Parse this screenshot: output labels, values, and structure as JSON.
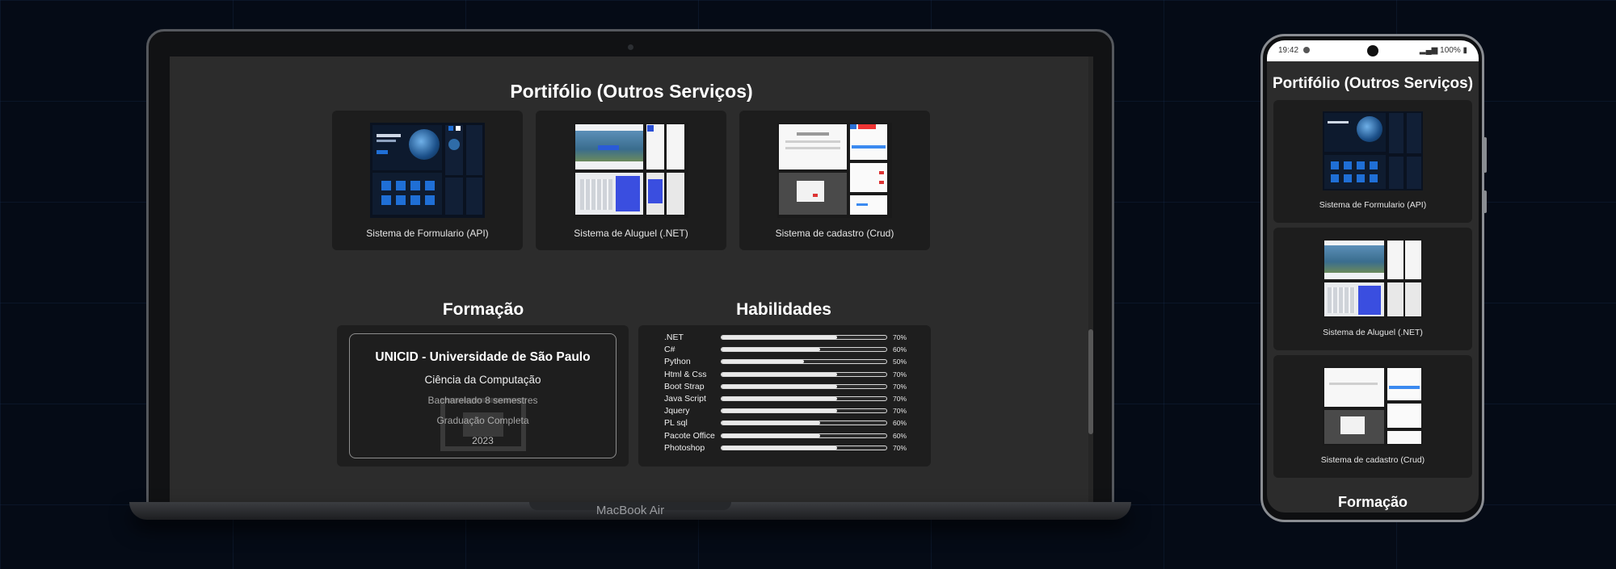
{
  "laptop": {
    "brand": "MacBook Air",
    "portfolio_title": "Portifólio (Outros Serviços)",
    "projects": [
      {
        "label": "Sistema de Formulario (API)",
        "thumb": "space-form"
      },
      {
        "label": "Sistema de Aluguel (.NET)",
        "thumb": "rental"
      },
      {
        "label": "Sistema de cadastro (Crud)",
        "thumb": "crud"
      }
    ],
    "formacao": {
      "title": "Formação",
      "institution": "UNICID - Universidade de São Paulo",
      "course": "Ciência da Computação",
      "degree": "Bacharelado 8 semestres",
      "status": "Graduação Completa",
      "year": "2023"
    },
    "habilidades": {
      "title": "Habilidades",
      "skills": [
        {
          "name": ".NET",
          "percent_label": "70%",
          "value": 70
        },
        {
          "name": "C#",
          "percent_label": "60%",
          "value": 60
        },
        {
          "name": "Python",
          "percent_label": "50%",
          "value": 50
        },
        {
          "name": "Html & Css",
          "percent_label": "70%",
          "value": 70
        },
        {
          "name": "Boot Strap",
          "percent_label": "70%",
          "value": 70
        },
        {
          "name": "Java Script",
          "percent_label": "70%",
          "value": 70
        },
        {
          "name": "Jquery",
          "percent_label": "70%",
          "value": 70
        },
        {
          "name": "PL sql",
          "percent_label": "60%",
          "value": 60
        },
        {
          "name": "Pacote Office",
          "percent_label": "60%",
          "value": 60
        },
        {
          "name": "Photoshop",
          "percent_label": "70%",
          "value": 70
        }
      ]
    }
  },
  "phone": {
    "status": {
      "time": "19:42",
      "battery": "100%"
    },
    "portfolio_title": "Portifólio (Outros Serviços)",
    "projects": [
      {
        "label": "Sistema de Formulario (API)"
      },
      {
        "label": "Sistema de Aluguel (.NET)"
      },
      {
        "label": "Sistema de cadastro (Crud)"
      }
    ],
    "formacao_title": "Formação"
  },
  "colors": {
    "background": "#050b16",
    "screen": "#2c2c2c",
    "card": "#1d1d1d",
    "accent_blue": "#1f6fd6"
  }
}
